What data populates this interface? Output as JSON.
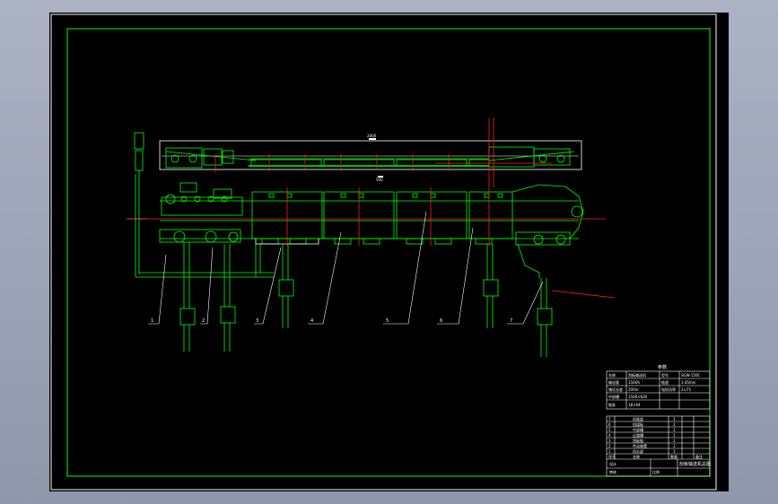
{
  "title_block": {
    "header": "参数",
    "params": [
      {
        "k1": "名称",
        "v1": "刮板输送机",
        "k2": "型号",
        "v2": "SGW-150C"
      },
      {
        "k1": "输送量",
        "v1": "150t/h",
        "k2": "链速",
        "v2": "1.05m/s"
      },
      {
        "k1": "铺设长度",
        "v1": "200m",
        "k2": "电机功率",
        "v2": "2×75"
      },
      {
        "k1": "中部槽",
        "v1": "1500×620",
        "k2": "",
        "v2": ""
      },
      {
        "k1": "链条",
        "v1": "18×64",
        "k2": "",
        "v2": ""
      }
    ],
    "parts": [
      {
        "no": "7",
        "name": "机尾部",
        "qty": "1"
      },
      {
        "no": "6",
        "name": "挡煤板",
        "qty": "1"
      },
      {
        "no": "5",
        "name": "中部槽",
        "qty": "1"
      },
      {
        "no": "4",
        "name": "过渡槽",
        "qty": "1"
      },
      {
        "no": "3",
        "name": "刮板链",
        "qty": "1"
      },
      {
        "no": "2",
        "name": "传动装置",
        "qty": "1"
      },
      {
        "no": "1",
        "name": "机头部",
        "qty": "1"
      }
    ],
    "parts_header": {
      "no": "序号",
      "name": "名称",
      "qty": "数量",
      "note": "备注"
    },
    "drawing_name": "刮板输送机总图",
    "footer_left": "设计",
    "footer_mid": "审核",
    "footer_right": "比例"
  },
  "callouts": [
    "1",
    "2",
    "3",
    "4",
    "5",
    "6",
    "7"
  ],
  "dimension_top": "2000",
  "dimension_mid": "500"
}
